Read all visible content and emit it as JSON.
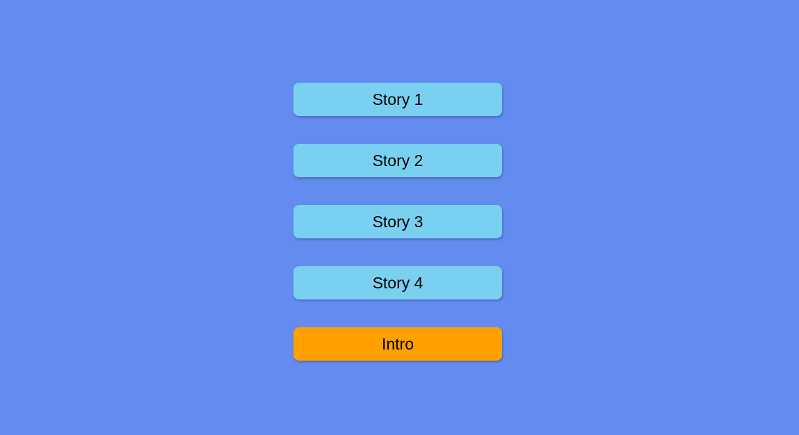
{
  "colors": {
    "background": "#648cf0",
    "story_button": "#7ad0f0",
    "intro_button": "#ffa000"
  },
  "menu": {
    "buttons": [
      {
        "label": "Story 1"
      },
      {
        "label": "Story 2"
      },
      {
        "label": "Story 3"
      },
      {
        "label": "Story 4"
      },
      {
        "label": "Intro"
      }
    ]
  }
}
